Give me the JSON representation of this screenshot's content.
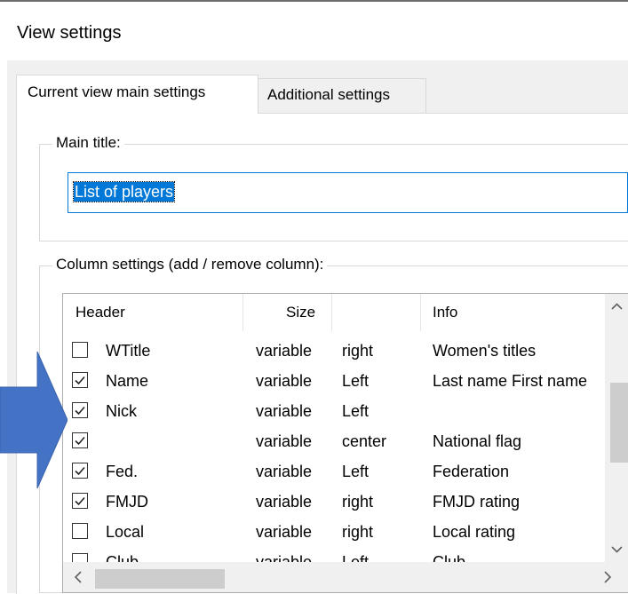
{
  "window": {
    "title": "View settings"
  },
  "tabs": [
    {
      "label": "Current view main settings",
      "active": true
    },
    {
      "label": "Additional settings",
      "active": false
    }
  ],
  "main_title": {
    "group_label": "Main title:",
    "value": "List of players"
  },
  "columns": {
    "group_label": "Column settings (add / remove column):",
    "headers": [
      "Header",
      "Size",
      "",
      "Info"
    ],
    "rows": [
      {
        "checked": false,
        "header": "WTitle",
        "size": "variable",
        "align": "right",
        "info": "Women's titles"
      },
      {
        "checked": true,
        "header": "Name",
        "size": "variable",
        "align": "Left",
        "info": "Last name First name"
      },
      {
        "checked": true,
        "header": "Nick",
        "size": "variable",
        "align": "Left",
        "info": ""
      },
      {
        "checked": true,
        "header": "",
        "size": "variable",
        "align": "center",
        "info": "National flag"
      },
      {
        "checked": true,
        "header": "Fed.",
        "size": "variable",
        "align": "Left",
        "info": "Federation"
      },
      {
        "checked": true,
        "header": "FMJD",
        "size": "variable",
        "align": "right",
        "info": "FMJD rating"
      },
      {
        "checked": false,
        "header": "Local",
        "size": "variable",
        "align": "right",
        "info": "Local rating"
      },
      {
        "checked": false,
        "header": "Club",
        "size": "variable",
        "align": "Left",
        "info": "Club"
      }
    ]
  },
  "colors": {
    "accent": "#0078d7",
    "annotation_arrow": "#4472c4"
  },
  "icons": {
    "scroll_up": "chevron-up-icon",
    "scroll_down": "chevron-down-icon",
    "scroll_left": "chevron-left-icon",
    "scroll_right": "chevron-right-icon",
    "check": "checkmark-icon",
    "annotation": "arrow-right-icon"
  }
}
